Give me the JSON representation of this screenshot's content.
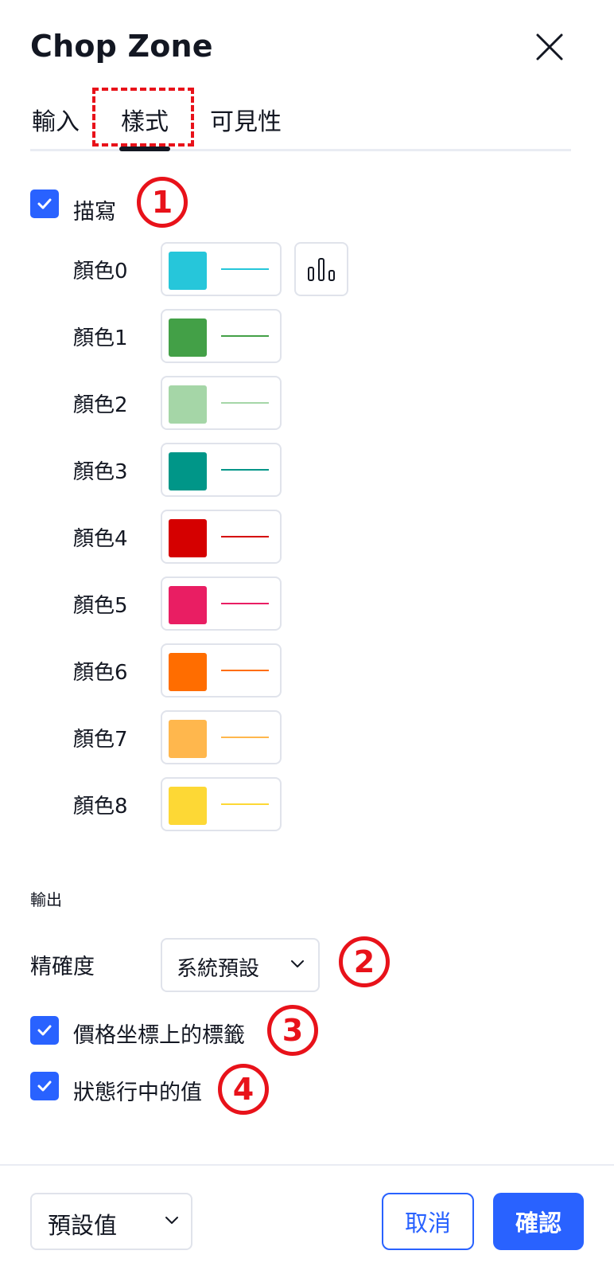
{
  "dialog": {
    "title": "Chop Zone"
  },
  "tabs": [
    {
      "label": "輸入"
    },
    {
      "label": "樣式",
      "active": true
    },
    {
      "label": "可見性"
    }
  ],
  "plot": {
    "label": "描寫",
    "checked": true,
    "colors": [
      {
        "label": "顏色0",
        "color": "#26c6da"
      },
      {
        "label": "顏色1",
        "color": "#43a047"
      },
      {
        "label": "顏色2",
        "color": "#a5d6a7"
      },
      {
        "label": "顏色3",
        "color": "#009688"
      },
      {
        "label": "顏色4",
        "color": "#d50000"
      },
      {
        "label": "顏色5",
        "color": "#e91e63"
      },
      {
        "label": "顏色6",
        "color": "#ff6d00"
      },
      {
        "label": "顏色7",
        "color": "#ffb74d"
      },
      {
        "label": "顏色8",
        "color": "#fdd835"
      }
    ],
    "plot_style_icon": "columns-icon"
  },
  "output": {
    "section_label": "輸出",
    "precision_label": "精確度",
    "precision_value": "系統預設",
    "price_scale_label": "價格坐標上的標籤",
    "price_scale_checked": true,
    "status_line_label": "狀態行中的值",
    "status_line_checked": true
  },
  "annotations": [
    "1",
    "2",
    "3",
    "4"
  ],
  "footer": {
    "preset_label": "預設值",
    "cancel_label": "取消",
    "ok_label": "確認"
  },
  "colors": {
    "accent": "#2962ff",
    "annotation_red": "#e8121a"
  }
}
